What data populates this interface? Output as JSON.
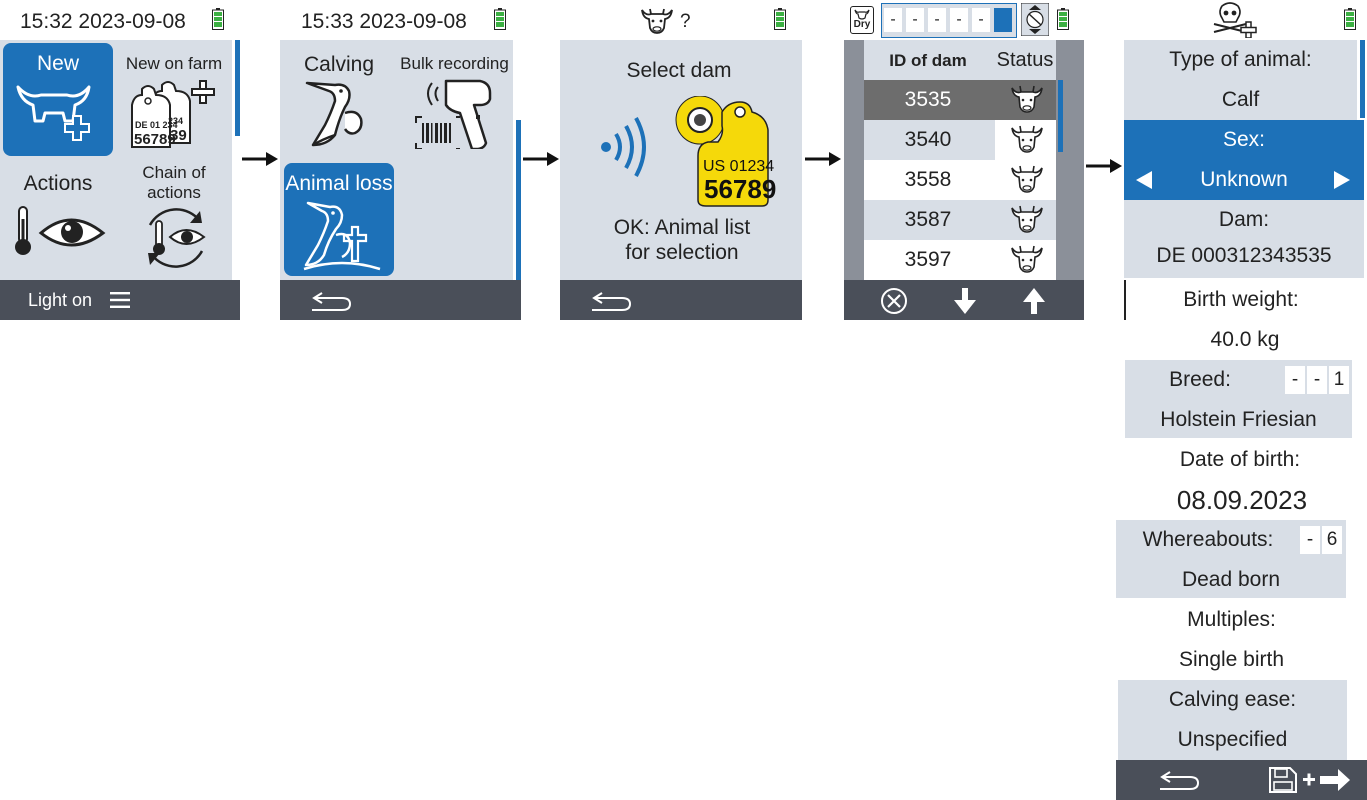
{
  "screen1": {
    "time": "15:32 2023-09-08",
    "tile_new": "New",
    "tile_new_on_farm": "New on farm",
    "tag_small_top": "DE 01 234",
    "tag_small_num": "56789",
    "tag_back_top": "234",
    "tag_back_num": "39",
    "tile_actions": "Actions",
    "tile_chain_line1": "Chain of",
    "tile_chain_line2": "actions",
    "footer_light": "Light on"
  },
  "screen2": {
    "time": "15:33 2023-09-08",
    "tile_calving": "Calving",
    "tile_bulk": "Bulk recording",
    "tile_animal_loss": "Animal loss"
  },
  "screen3": {
    "status_question": "?",
    "title": "Select dam",
    "tag_country": "US 01234",
    "tag_number": "56789",
    "hint_line1": "OK: Animal list",
    "hint_line2": "for selection"
  },
  "screen4": {
    "dry_label": "Dry",
    "filter_digits": [
      "-",
      "-",
      "-",
      "-",
      "-",
      ""
    ],
    "col_id": "ID of dam",
    "col_status": "Status",
    "rows": [
      {
        "id": "3535"
      },
      {
        "id": "3540"
      },
      {
        "id": "3558"
      },
      {
        "id": "3587"
      },
      {
        "id": "3597"
      }
    ]
  },
  "screen5": {
    "type_label": "Type of animal:",
    "type_value": "Calf",
    "sex_label": "Sex:",
    "sex_value": "Unknown",
    "dam_label": "Dam:",
    "dam_value": "DE 000312343535",
    "weight_label": "Birth weight:",
    "weight_value": "40.0 kg",
    "breed_label": "Breed:",
    "breed_digits": [
      "-",
      "-",
      "1"
    ],
    "breed_value": "Holstein Friesian",
    "dob_label": "Date of birth:",
    "dob_value": "08.09.2023",
    "where_label": "Whereabouts:",
    "where_digits": [
      "-",
      "6"
    ],
    "where_value": "Dead born",
    "multiples_label": "Multiples:",
    "multiples_value": "Single birth",
    "ease_label": "Calving ease:",
    "ease_value": "Unspecified"
  },
  "colors": {
    "accent": "#1d71b8",
    "panel": "#d8dee6",
    "footer": "#4a4f59",
    "battery": "#3cb043",
    "tag_yellow": "#f5d90a"
  }
}
